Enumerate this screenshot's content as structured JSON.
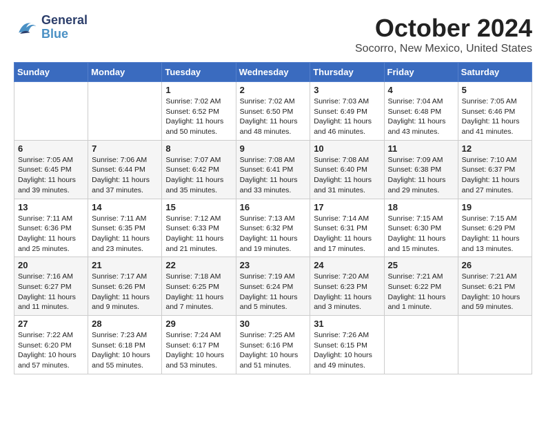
{
  "header": {
    "logo_general": "General",
    "logo_blue": "Blue",
    "month": "October 2024",
    "location": "Socorro, New Mexico, United States"
  },
  "days_of_week": [
    "Sunday",
    "Monday",
    "Tuesday",
    "Wednesday",
    "Thursday",
    "Friday",
    "Saturday"
  ],
  "weeks": [
    [
      {
        "day": "",
        "content": ""
      },
      {
        "day": "",
        "content": ""
      },
      {
        "day": "1",
        "content": "Sunrise: 7:02 AM\nSunset: 6:52 PM\nDaylight: 11 hours and 50 minutes."
      },
      {
        "day": "2",
        "content": "Sunrise: 7:02 AM\nSunset: 6:50 PM\nDaylight: 11 hours and 48 minutes."
      },
      {
        "day": "3",
        "content": "Sunrise: 7:03 AM\nSunset: 6:49 PM\nDaylight: 11 hours and 46 minutes."
      },
      {
        "day": "4",
        "content": "Sunrise: 7:04 AM\nSunset: 6:48 PM\nDaylight: 11 hours and 43 minutes."
      },
      {
        "day": "5",
        "content": "Sunrise: 7:05 AM\nSunset: 6:46 PM\nDaylight: 11 hours and 41 minutes."
      }
    ],
    [
      {
        "day": "6",
        "content": "Sunrise: 7:05 AM\nSunset: 6:45 PM\nDaylight: 11 hours and 39 minutes."
      },
      {
        "day": "7",
        "content": "Sunrise: 7:06 AM\nSunset: 6:44 PM\nDaylight: 11 hours and 37 minutes."
      },
      {
        "day": "8",
        "content": "Sunrise: 7:07 AM\nSunset: 6:42 PM\nDaylight: 11 hours and 35 minutes."
      },
      {
        "day": "9",
        "content": "Sunrise: 7:08 AM\nSunset: 6:41 PM\nDaylight: 11 hours and 33 minutes."
      },
      {
        "day": "10",
        "content": "Sunrise: 7:08 AM\nSunset: 6:40 PM\nDaylight: 11 hours and 31 minutes."
      },
      {
        "day": "11",
        "content": "Sunrise: 7:09 AM\nSunset: 6:38 PM\nDaylight: 11 hours and 29 minutes."
      },
      {
        "day": "12",
        "content": "Sunrise: 7:10 AM\nSunset: 6:37 PM\nDaylight: 11 hours and 27 minutes."
      }
    ],
    [
      {
        "day": "13",
        "content": "Sunrise: 7:11 AM\nSunset: 6:36 PM\nDaylight: 11 hours and 25 minutes."
      },
      {
        "day": "14",
        "content": "Sunrise: 7:11 AM\nSunset: 6:35 PM\nDaylight: 11 hours and 23 minutes."
      },
      {
        "day": "15",
        "content": "Sunrise: 7:12 AM\nSunset: 6:33 PM\nDaylight: 11 hours and 21 minutes."
      },
      {
        "day": "16",
        "content": "Sunrise: 7:13 AM\nSunset: 6:32 PM\nDaylight: 11 hours and 19 minutes."
      },
      {
        "day": "17",
        "content": "Sunrise: 7:14 AM\nSunset: 6:31 PM\nDaylight: 11 hours and 17 minutes."
      },
      {
        "day": "18",
        "content": "Sunrise: 7:15 AM\nSunset: 6:30 PM\nDaylight: 11 hours and 15 minutes."
      },
      {
        "day": "19",
        "content": "Sunrise: 7:15 AM\nSunset: 6:29 PM\nDaylight: 11 hours and 13 minutes."
      }
    ],
    [
      {
        "day": "20",
        "content": "Sunrise: 7:16 AM\nSunset: 6:27 PM\nDaylight: 11 hours and 11 minutes."
      },
      {
        "day": "21",
        "content": "Sunrise: 7:17 AM\nSunset: 6:26 PM\nDaylight: 11 hours and 9 minutes."
      },
      {
        "day": "22",
        "content": "Sunrise: 7:18 AM\nSunset: 6:25 PM\nDaylight: 11 hours and 7 minutes."
      },
      {
        "day": "23",
        "content": "Sunrise: 7:19 AM\nSunset: 6:24 PM\nDaylight: 11 hours and 5 minutes."
      },
      {
        "day": "24",
        "content": "Sunrise: 7:20 AM\nSunset: 6:23 PM\nDaylight: 11 hours and 3 minutes."
      },
      {
        "day": "25",
        "content": "Sunrise: 7:21 AM\nSunset: 6:22 PM\nDaylight: 11 hours and 1 minute."
      },
      {
        "day": "26",
        "content": "Sunrise: 7:21 AM\nSunset: 6:21 PM\nDaylight: 10 hours and 59 minutes."
      }
    ],
    [
      {
        "day": "27",
        "content": "Sunrise: 7:22 AM\nSunset: 6:20 PM\nDaylight: 10 hours and 57 minutes."
      },
      {
        "day": "28",
        "content": "Sunrise: 7:23 AM\nSunset: 6:18 PM\nDaylight: 10 hours and 55 minutes."
      },
      {
        "day": "29",
        "content": "Sunrise: 7:24 AM\nSunset: 6:17 PM\nDaylight: 10 hours and 53 minutes."
      },
      {
        "day": "30",
        "content": "Sunrise: 7:25 AM\nSunset: 6:16 PM\nDaylight: 10 hours and 51 minutes."
      },
      {
        "day": "31",
        "content": "Sunrise: 7:26 AM\nSunset: 6:15 PM\nDaylight: 10 hours and 49 minutes."
      },
      {
        "day": "",
        "content": ""
      },
      {
        "day": "",
        "content": ""
      }
    ]
  ]
}
